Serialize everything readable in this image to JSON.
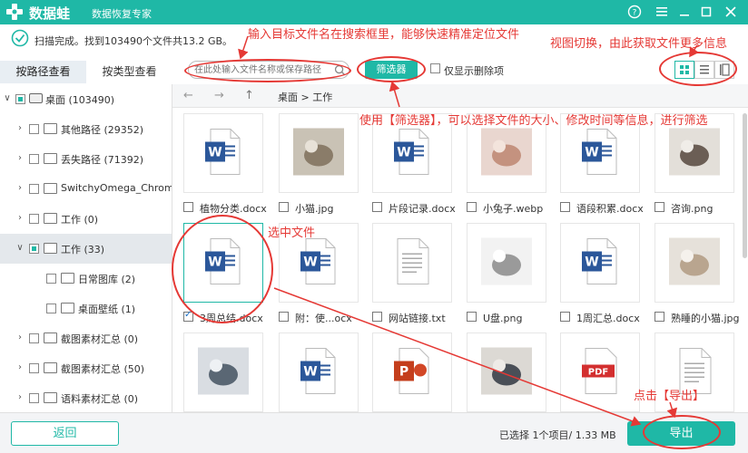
{
  "titlebar": {
    "app_name": "数据蛙",
    "subtitle": "数据恢复专家",
    "help_icon": "help-icon",
    "menu_icon": "menu-icon",
    "minimize_icon": "minimize-icon",
    "maximize_icon": "maximize-icon",
    "close_icon": "close-icon",
    "brand_color": "#1fb8a6"
  },
  "scan": {
    "status": "扫描完成。找到103490个文件共13.2 GB。"
  },
  "tabs": [
    {
      "label": "按路径查看",
      "active": true
    },
    {
      "label": "按类型查看",
      "active": false
    }
  ],
  "tree": [
    {
      "label": "桌面 (103490)",
      "expanded": true,
      "checked": "partial",
      "type": "drive"
    },
    {
      "label": "其他路径 (29352)",
      "expanded": false,
      "checked": false,
      "type": "folder"
    },
    {
      "label": "丢失路径 (71392)",
      "expanded": false,
      "checked": false,
      "type": "folder"
    },
    {
      "label": "SwitchyOmega_Chromium",
      "expanded": false,
      "checked": false,
      "type": "folder"
    },
    {
      "label": "工作 (0)",
      "expanded": false,
      "checked": false,
      "type": "folder"
    },
    {
      "label": "工作 (33)",
      "expanded": true,
      "checked": "partial",
      "type": "folder",
      "selected": true
    },
    {
      "label": "日常图库 (2)",
      "expanded": false,
      "checked": false,
      "type": "folder"
    },
    {
      "label": "桌面壁纸 (1)",
      "expanded": false,
      "checked": false,
      "type": "folder"
    },
    {
      "label": "截图素材汇总 (0)",
      "expanded": false,
      "checked": false,
      "type": "folder"
    },
    {
      "label": "截图素材汇总 (50)",
      "expanded": false,
      "checked": false,
      "type": "folder"
    },
    {
      "label": "语料素材汇总 (0)",
      "expanded": false,
      "checked": false,
      "type": "folder"
    }
  ],
  "toolbar": {
    "search_placeholder": "在此处输入文件名称或保存路径",
    "filter_label": "筛选器",
    "show_deleted_label": "仅显示删除项"
  },
  "nav": {
    "back_icon": "arrow-left-icon",
    "forward_icon": "arrow-right-icon",
    "up_icon": "arrow-up-icon",
    "breadcrumb": "桌面 > 工作"
  },
  "files": [
    {
      "name": "植物分类.docx",
      "kind": "word",
      "checked": false
    },
    {
      "name": "小猫.jpg",
      "kind": "photo-cat",
      "checked": false
    },
    {
      "name": "片段记录.docx",
      "kind": "word",
      "checked": false
    },
    {
      "name": "小兔子.webp",
      "kind": "photo-rabbit",
      "checked": false
    },
    {
      "name": "语段积累.docx",
      "kind": "word",
      "checked": false
    },
    {
      "name": "咨询.png",
      "kind": "photo-meeting",
      "checked": false
    },
    {
      "name": "3周总结.docx",
      "kind": "word",
      "checked": true,
      "selected": true
    },
    {
      "name": "附：使...ocx",
      "kind": "word",
      "checked": false
    },
    {
      "name": "网站链接.txt",
      "kind": "text",
      "checked": false
    },
    {
      "name": "U盘.png",
      "kind": "photo-usb",
      "checked": false
    },
    {
      "name": "1周汇总.docx",
      "kind": "word",
      "checked": false
    },
    {
      "name": "熟睡的小猫.jpg",
      "kind": "photo-cat2",
      "checked": false
    },
    {
      "name": "",
      "kind": "photo-laptop",
      "checked": false
    },
    {
      "name": "",
      "kind": "word",
      "checked": false
    },
    {
      "name": "",
      "kind": "ppt",
      "checked": false
    },
    {
      "name": "",
      "kind": "photo-desk",
      "checked": false
    },
    {
      "name": "",
      "kind": "pdf",
      "checked": false
    },
    {
      "name": "",
      "kind": "text",
      "checked": false
    }
  ],
  "file_icon_labels": {
    "word": "W",
    "ppt": "P",
    "pdf": "PDF"
  },
  "bottom": {
    "back_label": "返回",
    "selection_info": "已选择 1个项目/ 1.33 MB",
    "export_label": "导出"
  },
  "annotations": {
    "search_tip": "输入目标文件名在搜索框里，能够快速精准定位文件",
    "view_tip": "视图切换，由此获取文件更多信息",
    "filter_tip": "使用【筛选器】，可以选择文件的大小、修改时间等信息，进行筛选",
    "select_tip": "选中文件",
    "export_tip": "点击【导出】",
    "color": "#e53935"
  }
}
